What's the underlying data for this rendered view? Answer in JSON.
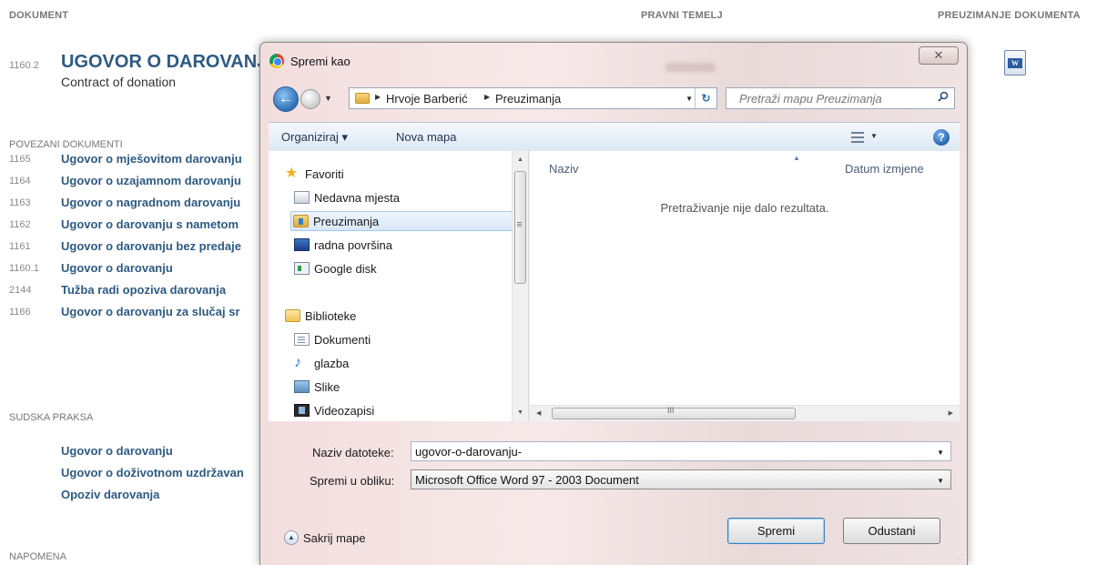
{
  "page": {
    "col_headers": {
      "dokument": "DOKUMENT",
      "pravni_temelj": "PRAVNI TEMELJ",
      "preuzimanje": "PREUZIMANJE DOKUMENTA"
    },
    "document": {
      "number": "1160.2",
      "title": "UGOVOR O DAROVANJ",
      "subtitle": "Contract of donation"
    },
    "sections": {
      "povezani": "POVEZANI DOKUMENTI",
      "sudska": "SUDSKA PRAKSA",
      "napomena": "NAPOMENA"
    },
    "related": [
      {
        "num": "1165",
        "label": "Ugovor o mješovitom darovanju"
      },
      {
        "num": "1164",
        "label": "Ugovor o uzajamnom darovanju"
      },
      {
        "num": "1163",
        "label": "Ugovor o nagradnom darovanju"
      },
      {
        "num": "1162",
        "label": "Ugovor o darovanju s nametom"
      },
      {
        "num": "1161",
        "label": "Ugovor o darovanju bez predaje"
      },
      {
        "num": "1160.1",
        "label": "Ugovor o darovanju"
      },
      {
        "num": "2144",
        "label": "Tužba radi opoziva darovanja"
      },
      {
        "num": "1166",
        "label": "Ugovor o darovanju za slučaj sr"
      }
    ],
    "case_law": [
      {
        "label": "Ugovor o darovanju"
      },
      {
        "label": "Ugovor o doživotnom uzdržavan"
      },
      {
        "label": "Opoziv darovanja"
      }
    ],
    "word_icon_label": "W"
  },
  "dialog": {
    "title": "Spremi kao",
    "close_glyph": "✕",
    "address": {
      "crumb1": "Hrvoje Barberić",
      "crumb2": "Preuzimanja"
    },
    "search_placeholder": "Pretraži mapu Preuzimanja",
    "toolbar": {
      "organize": "Organiziraj ▾",
      "new_folder": "Nova mapa"
    },
    "nav": {
      "favorites": "Favoriti",
      "recent": "Nedavna mjesta",
      "downloads": "Preuzimanja",
      "desktop": "radna površina",
      "gdisk": "Google disk",
      "libraries": "Biblioteke",
      "documents": "Dokumenti",
      "music": "glazba",
      "pictures": "Slike",
      "videos": "Videozapisi"
    },
    "columns": {
      "name": "Naziv",
      "date": "Datum izmjene"
    },
    "empty_message": "Pretraživanje nije dalo rezultata.",
    "filename_label": "Naziv datoteke:",
    "filename_value": "ugovor-o-darovanju-",
    "savetype_label": "Spremi u obliku:",
    "savetype_value": "Microsoft Office Word 97 - 2003 Document",
    "hide_folders": "Sakrij mape",
    "save_button": "Spremi",
    "cancel_button": "Odustani",
    "hscroll_glyph": "III"
  }
}
